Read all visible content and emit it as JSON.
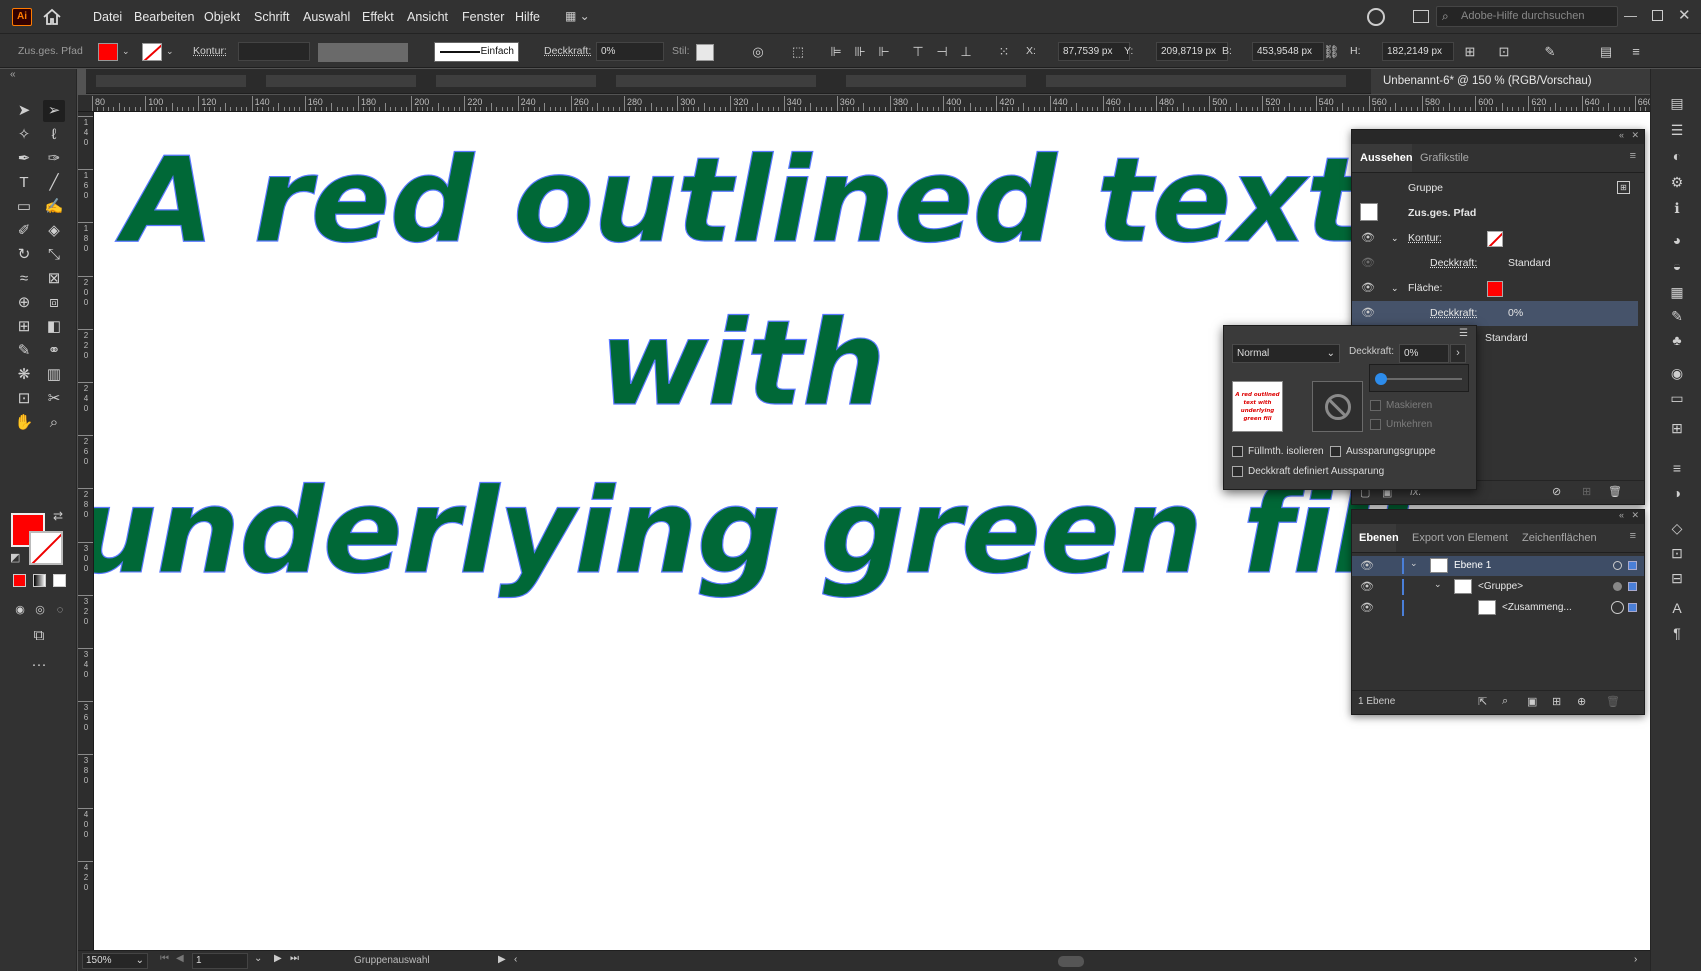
{
  "app": {
    "logo": "Ai"
  },
  "menu": [
    "Datei",
    "Bearbeiten",
    "Objekt",
    "Schrift",
    "Auswahl",
    "Effekt",
    "Ansicht",
    "Fenster",
    "Hilfe"
  ],
  "search": {
    "placeholder": "Adobe-Hilfe durchsuchen"
  },
  "control": {
    "selection_type": "Zus.ges. Pfad",
    "fill_color": "#ff0000",
    "stroke_label": "Kontur:",
    "stroke_style": "Einfach",
    "opacity_label": "Deckkraft:",
    "opacity_value": "0%",
    "style_label": "Stil:",
    "x_label": "X:",
    "x_value": "87,7539 px",
    "y_label": "Y:",
    "y_value": "209,8719 px",
    "w_label": "B:",
    "w_value": "453,9548 px",
    "h_label": "H:",
    "h_value": "182,2149 px"
  },
  "document_tab": {
    "title": "Unbenannt-6* @ 150 % (RGB/Vorschau)",
    "close": "×"
  },
  "ruler_top": [
    "80",
    "100",
    "120",
    "140",
    "160",
    "180",
    "200",
    "220",
    "240",
    "260",
    "280",
    "300",
    "320",
    "340",
    "360",
    "380",
    "400",
    "420",
    "440",
    "460",
    "480",
    "500",
    "520",
    "540",
    "560",
    "580",
    "600",
    "620",
    "640",
    "660"
  ],
  "ruler_left": [
    "1\n4\n0",
    "1\n6\n0",
    "1\n8\n0",
    "2\n0\n0",
    "2\n2\n0",
    "2\n4\n0",
    "2\n6\n0",
    "2\n8\n0",
    "3\n0\n0",
    "3\n2\n0",
    "3\n4\n0",
    "3\n6\n0",
    "3\n8\n0",
    "4\n0\n0",
    "4\n2\n0"
  ],
  "artwork": {
    "lines": [
      "A red outlined text",
      "with",
      "underlying green fill"
    ],
    "fill_color": "#006837",
    "anchor_color": "#5a78ff"
  },
  "appearance_panel": {
    "tabs": [
      "Aussehen",
      "Grafikstile"
    ],
    "group_label": "Gruppe",
    "object_label": "Zus.ges. Pfad",
    "rows": [
      {
        "label": "Kontur:",
        "value": ""
      },
      {
        "label": "Deckkraft:",
        "value": "Standard"
      },
      {
        "label": "Fläche:",
        "value": ""
      },
      {
        "label": "Deckkraft:",
        "value": "0%"
      },
      {
        "label": "",
        "value": "Standard"
      }
    ],
    "fx_label": "fx."
  },
  "transparency": {
    "blend_mode": "Normal",
    "opacity_label": "Deckkraft:",
    "opacity_value": "0%",
    "thumb_text": "A red outlined text with underlying green fill",
    "mask_label": "Maskieren",
    "invert_label": "Umkehren",
    "isolate_label": "Füllmth. isolieren",
    "knockout_label": "Aussparungsgruppe",
    "opacity_defines_label": "Deckkraft definiert Aussparung"
  },
  "layers_panel": {
    "tabs": [
      "Ebenen",
      "Export von Element",
      "Zeichenflächen"
    ],
    "rows": [
      {
        "name": "Ebene 1"
      },
      {
        "name": "<Gruppe>"
      },
      {
        "name": "<Zusammeng..."
      }
    ],
    "footer": "1 Ebene"
  },
  "status": {
    "zoom": "150%",
    "page": "1",
    "tool": "Gruppenauswahl"
  }
}
